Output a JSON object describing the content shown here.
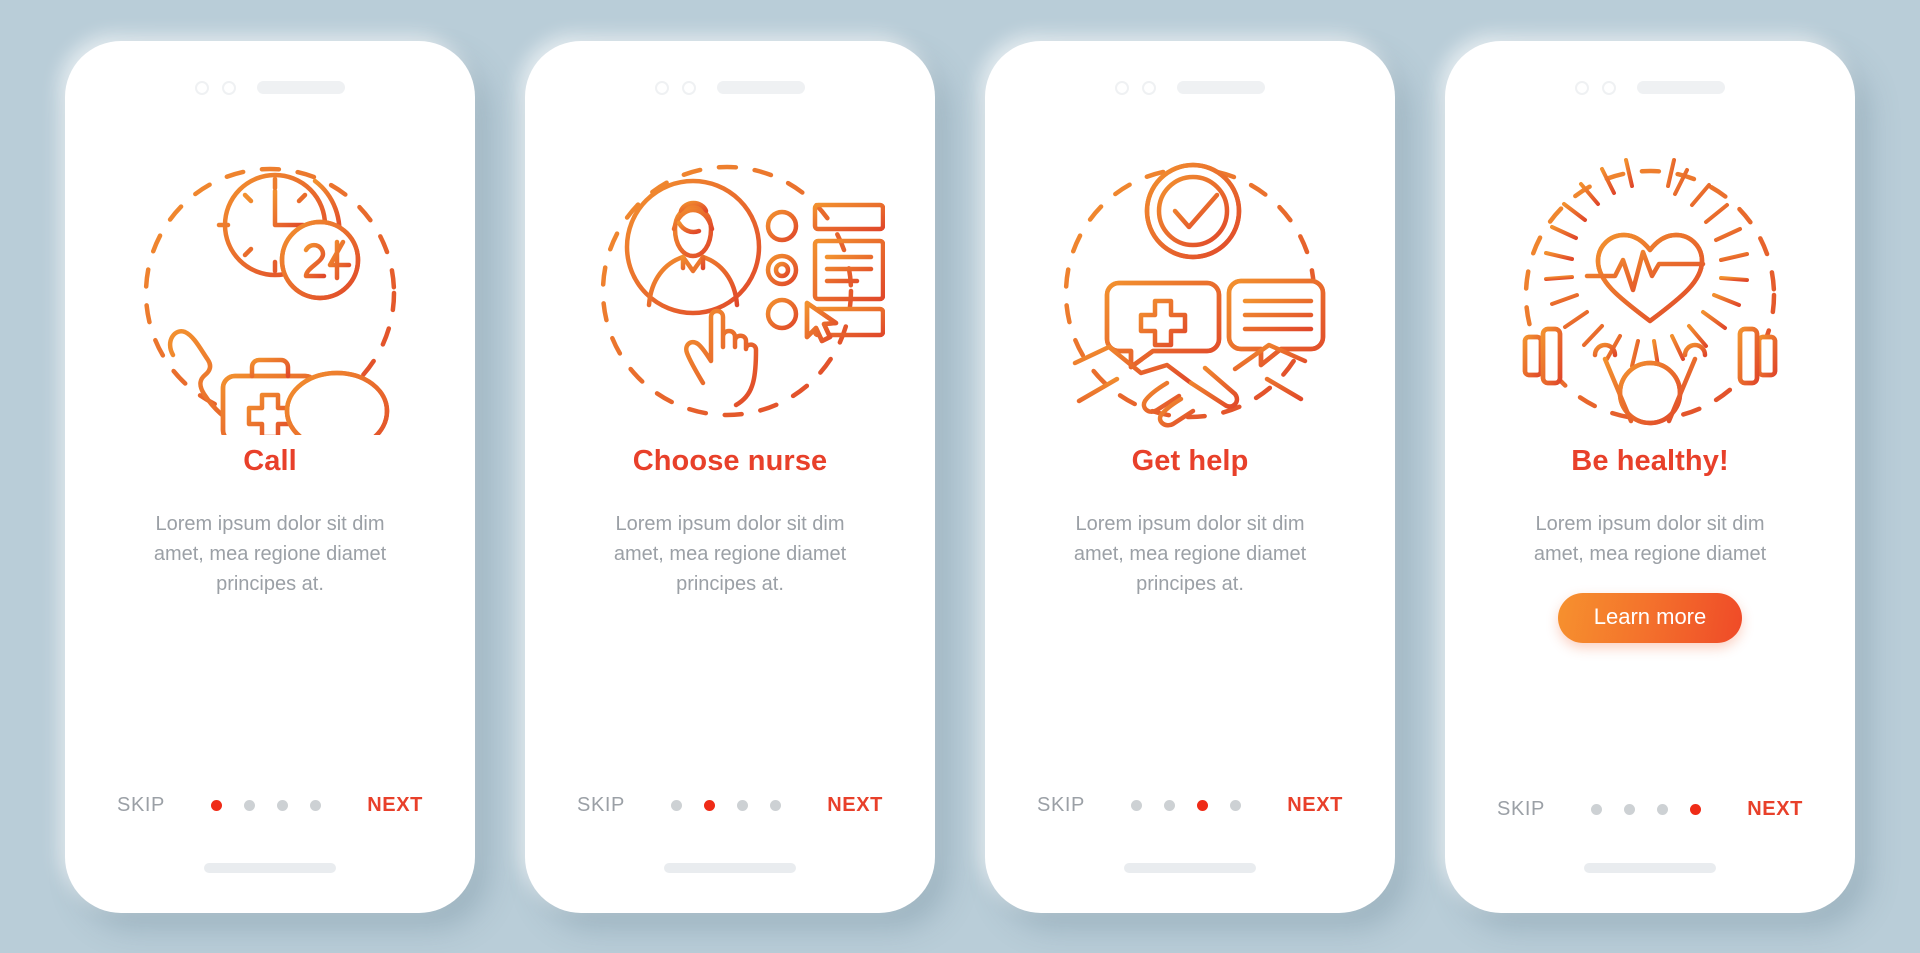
{
  "background_color": "#b9cdd8",
  "accent": {
    "title_red": "#e8402a",
    "dot_active": "#ef2b17",
    "dot_inactive": "#cdd1d4",
    "muted_text": "#9ba0a6",
    "gradient_start": "#f6912e",
    "gradient_end": "#ef4a28"
  },
  "nav": {
    "skip_label": "SKIP",
    "next_label": "NEXT",
    "total_steps": 4
  },
  "screens": [
    {
      "title": "Call",
      "description": "Lorem ipsum dolor sit dim amet, mea regione diamet principes at.",
      "active_step": 1,
      "illustration": "call-support-icon",
      "illustration_parts": [
        "phone-handset-icon",
        "clock-24h-icon",
        "first-aid-kit-icon",
        "info-bubble-icon",
        "dashed-circle"
      ],
      "has_cta": false,
      "cta_label": ""
    },
    {
      "title": "Choose nurse",
      "description": "Lorem ipsum dolor sit dim amet, mea regione diamet principes at.",
      "active_step": 2,
      "illustration": "choose-nurse-icon",
      "illustration_parts": [
        "nurse-avatar-icon",
        "pointing-hand-icon",
        "radio-list-icon",
        "form-panel-icon",
        "cursor-icon",
        "dashed-circle"
      ],
      "has_cta": false,
      "cta_label": ""
    },
    {
      "title": "Get help",
      "description": "Lorem ipsum dolor sit dim amet, mea regione diamet principes at.",
      "active_step": 3,
      "illustration": "get-help-icon",
      "illustration_parts": [
        "check-circle-icon",
        "medical-bubble-icon",
        "message-bubble-icon",
        "handshake-icon",
        "dashed-circle"
      ],
      "has_cta": false,
      "cta_label": ""
    },
    {
      "title": "Be healthy!",
      "description": "Lorem ipsum dolor sit dim amet, mea regione diamet",
      "active_step": 4,
      "illustration": "be-healthy-icon",
      "illustration_parts": [
        "radiant-heart-pulse-icon",
        "weightlifter-barbell-icon",
        "dashed-circle"
      ],
      "has_cta": true,
      "cta_label": "Learn more"
    }
  ]
}
